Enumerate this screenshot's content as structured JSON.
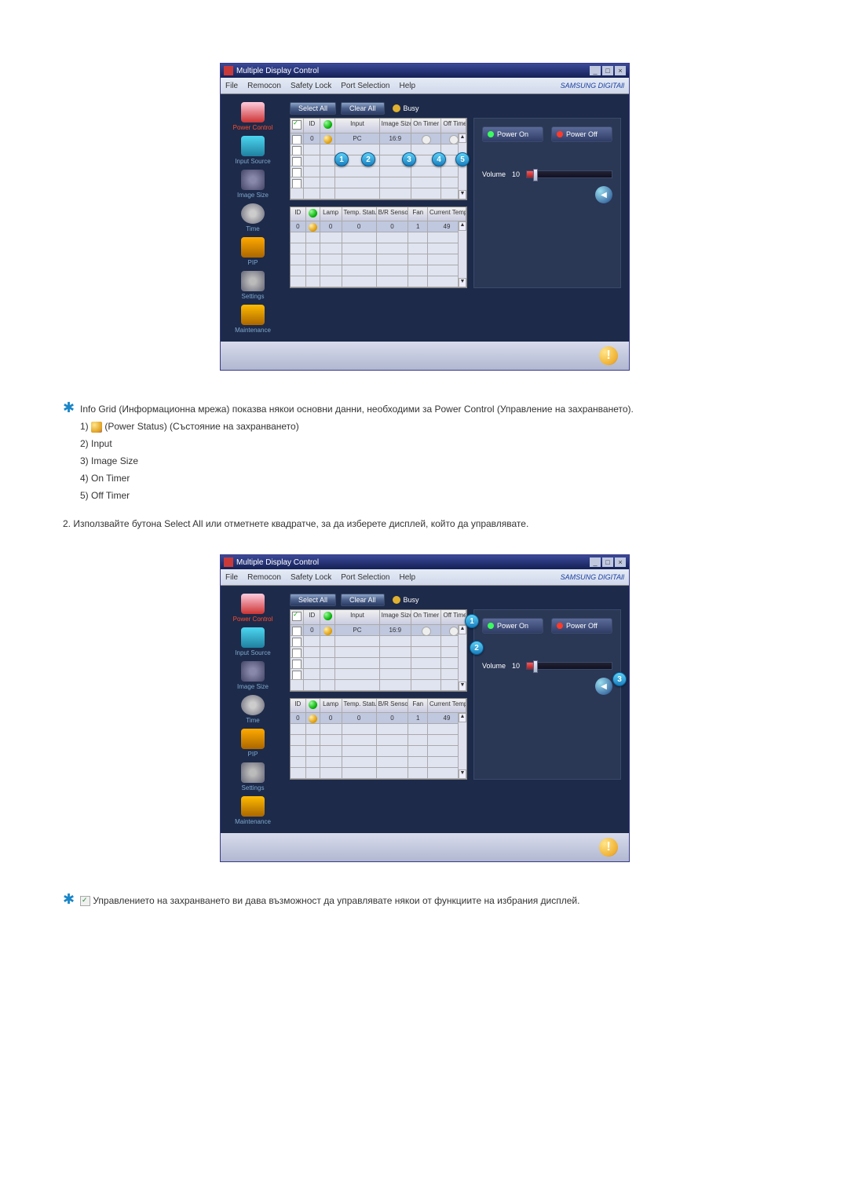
{
  "app": {
    "title": "Multiple Display Control",
    "menu": [
      "File",
      "Remocon",
      "Safety Lock",
      "Port Selection",
      "Help"
    ],
    "brand": "SAMSUNG DIGITAll"
  },
  "sidebar": {
    "items": [
      {
        "label": "Power Control"
      },
      {
        "label": "Input Source"
      },
      {
        "label": "Image Size"
      },
      {
        "label": "Time"
      },
      {
        "label": "PIP"
      },
      {
        "label": "Settings"
      },
      {
        "label": "Maintenance"
      }
    ]
  },
  "toolbar": {
    "select_all": "Select All",
    "clear_all": "Clear All",
    "busy": "Busy"
  },
  "grid1": {
    "headers": {
      "chk": "",
      "id": "ID",
      "ps": "",
      "input": "Input",
      "size": "Image Size",
      "ont": "On Timer",
      "offt": "Off Timer"
    },
    "row": {
      "id": "0",
      "input": "PC",
      "size": "16:9"
    }
  },
  "grid2": {
    "headers": {
      "id": "ID",
      "ps": "",
      "lamp": "Lamp",
      "temp": "Temp. Status",
      "bvr": "B/R Sensor",
      "fan": "Fan",
      "ctemp": "Current Temp."
    },
    "row": {
      "id": "0",
      "lamp": "0",
      "temp": "0",
      "bvr": "0",
      "fan": "1",
      "ctemp": "49"
    }
  },
  "power": {
    "on_label": "Power On",
    "off_label": "Power Off",
    "volume_label": "Volume",
    "volume_value": "10"
  },
  "callouts_img1": {
    "c1": "1",
    "c2": "2",
    "c3": "3",
    "c4": "4",
    "c5": "5"
  },
  "callouts_img2": {
    "c1": "1",
    "c2": "2",
    "c3": "3"
  },
  "text1": {
    "main": "Info Grid (Информационна мрежа) показва някои основни данни, необходими за Power Control (Управление на захранването).",
    "l1": "1) ",
    "l1b": " (Power Status) (Състояние на захранването)",
    "l2": "2) Input",
    "l3": "3) Image Size",
    "l4": "4) On Timer",
    "l5": "5) Off Timer"
  },
  "text2": "2.  Използвайте бутона Select All или отметнете квадратче, за да изберете дисплей, който да управлявате.",
  "text3": " Управлението на захранването ви дава възможност да управлявате някои от функциите на избрания дисплей."
}
